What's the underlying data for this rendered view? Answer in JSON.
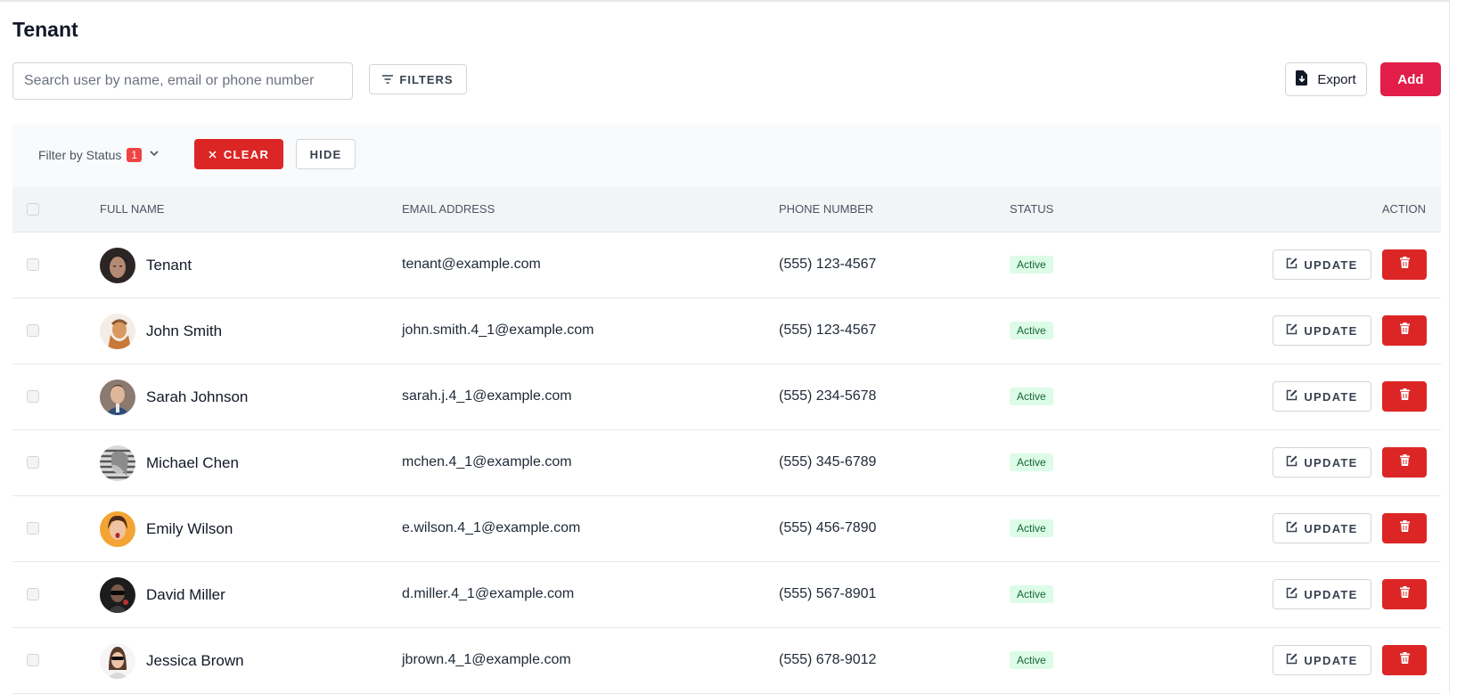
{
  "page": {
    "title": "Tenant"
  },
  "toolbar": {
    "search_placeholder": "Search user by name, email or phone number",
    "filters_label": "FILTERS",
    "export_label": "Export",
    "add_label": "Add"
  },
  "filter_bar": {
    "status_label": "Filter by Status",
    "status_count": "1",
    "clear_label": "CLEAR",
    "hide_label": "HIDE"
  },
  "table": {
    "columns": [
      "FULL NAME",
      "EMAIL ADDRESS",
      "PHONE NUMBER",
      "STATUS",
      "ACTION"
    ],
    "update_label": "UPDATE",
    "rows": [
      {
        "name": "Tenant",
        "email": "tenant@example.com",
        "phone": "(555) 123-4567",
        "status": "Active"
      },
      {
        "name": "John Smith",
        "email": "john.smith.4_1@example.com",
        "phone": "(555) 123-4567",
        "status": "Active"
      },
      {
        "name": "Sarah Johnson",
        "email": "sarah.j.4_1@example.com",
        "phone": "(555) 234-5678",
        "status": "Active"
      },
      {
        "name": "Michael Chen",
        "email": "mchen.4_1@example.com",
        "phone": "(555) 345-6789",
        "status": "Active"
      },
      {
        "name": "Emily Wilson",
        "email": "e.wilson.4_1@example.com",
        "phone": "(555) 456-7890",
        "status": "Active"
      },
      {
        "name": "David Miller",
        "email": "d.miller.4_1@example.com",
        "phone": "(555) 567-8901",
        "status": "Active"
      },
      {
        "name": "Jessica Brown",
        "email": "jbrown.4_1@example.com",
        "phone": "(555) 678-9012",
        "status": "Active"
      }
    ]
  },
  "colors": {
    "primary_add": "#e11d48",
    "danger": "#dc2626",
    "status_bg": "#dcfce7",
    "status_text": "#166534"
  },
  "icons": {
    "filters": "filter-lines-icon",
    "export": "file-download-icon",
    "filter_dropdown": "chevron-down-icon",
    "clear": "close-icon",
    "update": "edit-icon",
    "delete": "trash-icon"
  }
}
